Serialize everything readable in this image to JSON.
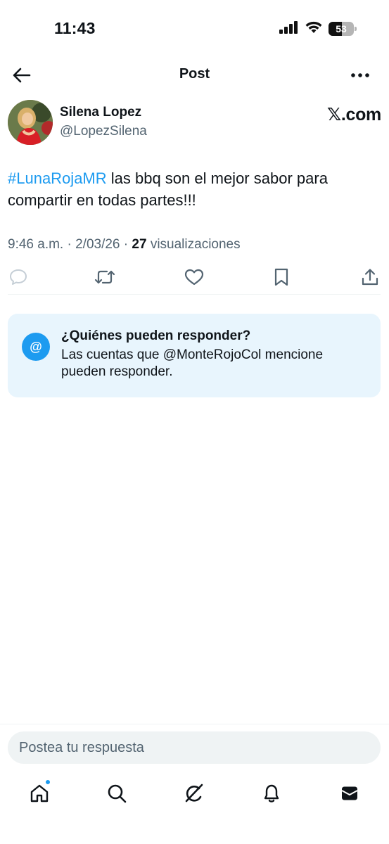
{
  "status_bar": {
    "time": "11:43",
    "battery": "53"
  },
  "nav": {
    "title": "Post"
  },
  "post": {
    "author_name": "Silena Lopez",
    "author_handle": "@LopezSilena",
    "source_label": "𝕏.com",
    "hashtag": "#LunaRojaMR",
    "text": " las bbq son el mejor sabor para compartir en todas partes!!!",
    "time": "9:46 a.m.",
    "separator": " · ",
    "date": "2/03/26",
    "views_count": "27",
    "views_label": " visualizaciones"
  },
  "actions": [
    "reply-icon",
    "repost-icon",
    "like-icon",
    "bookmark-icon",
    "share-icon"
  ],
  "reply_notice": {
    "icon": "@",
    "title": "¿Quiénes pueden responder?",
    "body": "Las cuentas que @MonteRojoCol mencione pueden responder."
  },
  "composer": {
    "placeholder": "Postea tu respuesta"
  },
  "tabs": [
    "home-icon",
    "search-icon",
    "grok-icon",
    "notifications-icon",
    "messages-icon"
  ],
  "colors": {
    "accent": "#1d9bf0",
    "text": "#0f1419",
    "muted": "#536471",
    "notice_bg": "#e8f5fd"
  }
}
